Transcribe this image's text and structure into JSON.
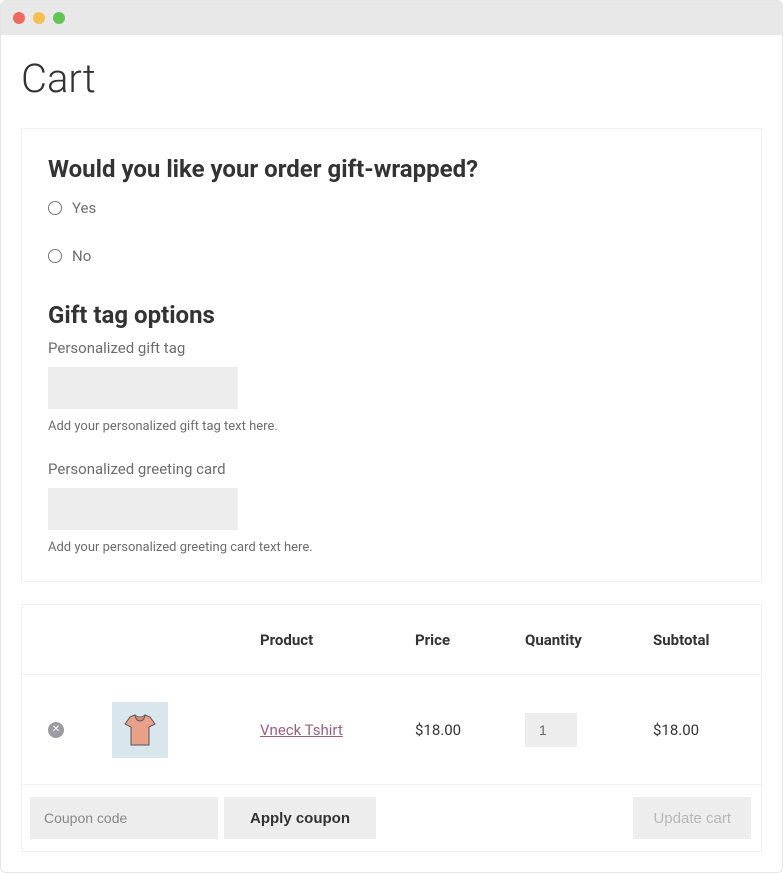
{
  "page": {
    "title": "Cart"
  },
  "gift_wrap": {
    "question": "Would you like your order gift-wrapped?",
    "options": {
      "yes": "Yes",
      "no": "No"
    },
    "tag_heading": "Gift tag options",
    "gift_tag": {
      "label": "Personalized gift tag",
      "value": "",
      "helper": "Add your personalized gift tag text here."
    },
    "greeting_card": {
      "label": "Personalized greeting card",
      "value": "",
      "helper": "Add your personalized greeting card text here."
    }
  },
  "table": {
    "headers": {
      "product": "Product",
      "price": "Price",
      "quantity": "Quantity",
      "subtotal": "Subtotal"
    },
    "rows": [
      {
        "product": "Vneck Tshirt",
        "price": "$18.00",
        "quantity": "1",
        "subtotal": "$18.00"
      }
    ]
  },
  "footer": {
    "coupon_placeholder": "Coupon code",
    "apply_label": "Apply coupon",
    "update_label": "Update cart"
  }
}
